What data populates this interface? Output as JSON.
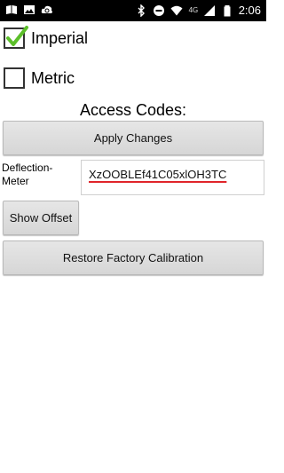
{
  "status_bar": {
    "network_label": "4G",
    "time": "2:06",
    "left_icons": [
      "book-icon",
      "image-icon",
      "cloud-sync-icon"
    ],
    "right_icons": [
      "bluetooth-icon",
      "do-not-disturb-icon",
      "wifi-icon",
      "signal-icon",
      "battery-icon"
    ]
  },
  "units": {
    "imperial": {
      "label": "Imperial",
      "checked": true
    },
    "metric": {
      "label": "Metric",
      "checked": false
    }
  },
  "access_codes": {
    "title": "Access Codes:",
    "apply_label": "Apply Changes",
    "field_label": "Deflection-Meter",
    "field_value": "XzOOBLEf41C05xlOH3TC"
  },
  "actions": {
    "show_offset_label": "Show Offset",
    "restore_label": "Restore Factory Calibration"
  },
  "colors": {
    "check_green": "#5cbf2a",
    "spellcheck_underline": "#e0242a",
    "button_bg": "#dcdcdc"
  }
}
